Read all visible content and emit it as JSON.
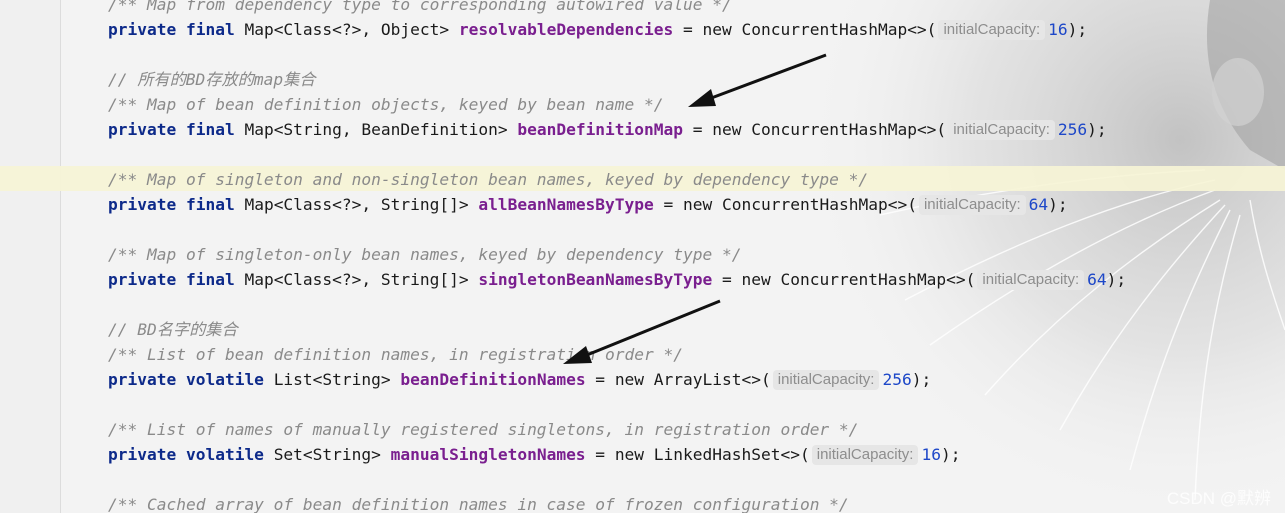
{
  "editor": {
    "lines": [
      {
        "kind": "comment",
        "text": "/** Map from dependency type to corresponding autowired value */"
      },
      {
        "kind": "code",
        "modifiers": "private final",
        "type": "Map<Class<?>, Object>",
        "field": "resolvableDependencies",
        "ctor": "new ConcurrentHashMap<>(",
        "hint_label": "initialCapacity:",
        "arg": "16"
      },
      {
        "kind": "comment",
        "text": "// 所有的BD存放的map集合"
      },
      {
        "kind": "comment",
        "text": "/** Map of bean definition objects, keyed by bean name */"
      },
      {
        "kind": "code",
        "modifiers": "private final",
        "type": "Map<String, BeanDefinition>",
        "field": "beanDefinitionMap",
        "ctor": "new ConcurrentHashMap<>(",
        "hint_label": "initialCapacity:",
        "arg": "256"
      },
      {
        "kind": "comment",
        "text": "/** Map of singleton and non-singleton bean names, keyed by dependency type */"
      },
      {
        "kind": "code",
        "modifiers": "private final",
        "type": "Map<Class<?>, String[]>",
        "field": "allBeanNamesByType",
        "ctor": "new ConcurrentHashMap<>(",
        "hint_label": "initialCapacity:",
        "arg": "64"
      },
      {
        "kind": "comment",
        "text": "/** Map of singleton-only bean names, keyed by dependency type */"
      },
      {
        "kind": "code",
        "modifiers": "private final",
        "type": "Map<Class<?>, String[]>",
        "field": "singletonBeanNamesByType",
        "ctor": "new ConcurrentHashMap<>(",
        "hint_label": "initialCapacity:",
        "arg": "64"
      },
      {
        "kind": "comment",
        "text": "// BD名字的集合"
      },
      {
        "kind": "comment",
        "text": "/** List of bean definition names, in registration order */"
      },
      {
        "kind": "code",
        "modifiers": "private volatile",
        "type": "List<String>",
        "field": "beanDefinitionNames",
        "ctor": "new ArrayList<>(",
        "hint_label": "initialCapacity:",
        "arg": "256"
      },
      {
        "kind": "comment",
        "text": "/** List of names of manually registered singletons, in registration order */"
      },
      {
        "kind": "code",
        "modifiers": "private volatile",
        "type": "Set<String>",
        "field": "manualSingletonNames",
        "ctor": "new LinkedHashSet<>(",
        "hint_label": "initialCapacity:",
        "arg": "16"
      },
      {
        "kind": "comment",
        "text": "/** Cached array of bean definition names in case of frozen configuration */"
      }
    ]
  },
  "watermark": "CSDN @默辨",
  "colors": {
    "keyword": "#0d2a8a",
    "field": "#7a1f8f",
    "number": "#1d47c8",
    "comment": "#8a8a8a",
    "current_line": "#f6f4d6"
  }
}
